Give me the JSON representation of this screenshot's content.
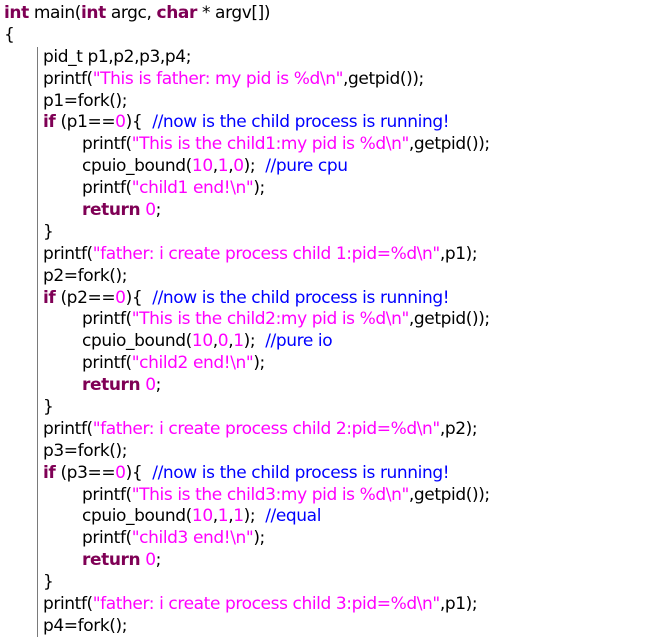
{
  "editor": {
    "lines": [
      {
        "parts": [
          {
            "t": "int",
            "c": "type"
          },
          {
            "t": " main(",
            "c": ""
          },
          {
            "t": "int",
            "c": "type"
          },
          {
            "t": " argc, ",
            "c": ""
          },
          {
            "t": "char",
            "c": "type"
          },
          {
            "t": " * argv[])",
            "c": ""
          }
        ],
        "indent": 0
      },
      {
        "parts": [
          {
            "t": "{",
            "c": ""
          }
        ],
        "indent": 0
      },
      {
        "parts": [
          {
            "t": "pid_t p1,p2,p3,p4;",
            "c": ""
          }
        ],
        "indent": 1
      },
      {
        "parts": [
          {
            "t": "printf(",
            "c": ""
          },
          {
            "t": "\"This is father: my pid is %d\\n\"",
            "c": "str"
          },
          {
            "t": ",getpid());",
            "c": ""
          }
        ],
        "indent": 1
      },
      {
        "parts": [
          {
            "t": "p1=fork();",
            "c": ""
          }
        ],
        "indent": 1
      },
      {
        "parts": [
          {
            "t": "if",
            "c": "kw"
          },
          {
            "t": " (p1==",
            "c": ""
          },
          {
            "t": "0",
            "c": "num"
          },
          {
            "t": "){  ",
            "c": ""
          },
          {
            "t": "//now is the child process is running!",
            "c": "cmt"
          }
        ],
        "indent": 1
      },
      {
        "parts": [
          {
            "t": "printf(",
            "c": ""
          },
          {
            "t": "\"This is the child1:my pid is %d\\n\"",
            "c": "str"
          },
          {
            "t": ",getpid());",
            "c": ""
          }
        ],
        "indent": 2
      },
      {
        "parts": [
          {
            "t": "cpuio_bound(",
            "c": ""
          },
          {
            "t": "10",
            "c": "num"
          },
          {
            "t": ",",
            "c": ""
          },
          {
            "t": "1",
            "c": "num"
          },
          {
            "t": ",",
            "c": ""
          },
          {
            "t": "0",
            "c": "num"
          },
          {
            "t": ");  ",
            "c": ""
          },
          {
            "t": "//pure cpu",
            "c": "cmt"
          }
        ],
        "indent": 2
      },
      {
        "parts": [
          {
            "t": "printf(",
            "c": ""
          },
          {
            "t": "\"child1 end!\\n\"",
            "c": "str"
          },
          {
            "t": ");",
            "c": ""
          }
        ],
        "indent": 2
      },
      {
        "parts": [
          {
            "t": "return",
            "c": "kw"
          },
          {
            "t": " ",
            "c": ""
          },
          {
            "t": "0",
            "c": "num"
          },
          {
            "t": ";",
            "c": ""
          }
        ],
        "indent": 2
      },
      {
        "parts": [
          {
            "t": "}",
            "c": ""
          }
        ],
        "indent": 1
      },
      {
        "parts": [
          {
            "t": "printf(",
            "c": ""
          },
          {
            "t": "\"father: i create process child 1:pid=%d\\n\"",
            "c": "str"
          },
          {
            "t": ",p1);",
            "c": ""
          }
        ],
        "indent": 1
      },
      {
        "parts": [
          {
            "t": "p2=fork();",
            "c": ""
          }
        ],
        "indent": 1
      },
      {
        "parts": [
          {
            "t": "if",
            "c": "kw"
          },
          {
            "t": " (p2==",
            "c": ""
          },
          {
            "t": "0",
            "c": "num"
          },
          {
            "t": "){  ",
            "c": ""
          },
          {
            "t": "//now is the child process is running!",
            "c": "cmt"
          }
        ],
        "indent": 1
      },
      {
        "parts": [
          {
            "t": "printf(",
            "c": ""
          },
          {
            "t": "\"This is the child2:my pid is %d\\n\"",
            "c": "str"
          },
          {
            "t": ",getpid());",
            "c": ""
          }
        ],
        "indent": 2
      },
      {
        "parts": [
          {
            "t": "cpuio_bound(",
            "c": ""
          },
          {
            "t": "10",
            "c": "num"
          },
          {
            "t": ",",
            "c": ""
          },
          {
            "t": "0",
            "c": "num"
          },
          {
            "t": ",",
            "c": ""
          },
          {
            "t": "1",
            "c": "num"
          },
          {
            "t": ");  ",
            "c": ""
          },
          {
            "t": "//pure io",
            "c": "cmt"
          }
        ],
        "indent": 2
      },
      {
        "parts": [
          {
            "t": "printf(",
            "c": ""
          },
          {
            "t": "\"child2 end!\\n\"",
            "c": "str"
          },
          {
            "t": ");",
            "c": ""
          }
        ],
        "indent": 2
      },
      {
        "parts": [
          {
            "t": "return",
            "c": "kw"
          },
          {
            "t": " ",
            "c": ""
          },
          {
            "t": "0",
            "c": "num"
          },
          {
            "t": ";",
            "c": ""
          }
        ],
        "indent": 2
      },
      {
        "parts": [
          {
            "t": "}",
            "c": ""
          }
        ],
        "indent": 1
      },
      {
        "parts": [
          {
            "t": "printf(",
            "c": ""
          },
          {
            "t": "\"father: i create process child 2:pid=%d\\n\"",
            "c": "str"
          },
          {
            "t": ",p2);",
            "c": ""
          }
        ],
        "indent": 1
      },
      {
        "parts": [
          {
            "t": "p3=fork();",
            "c": ""
          }
        ],
        "indent": 1
      },
      {
        "parts": [
          {
            "t": "if",
            "c": "kw"
          },
          {
            "t": " (p3==",
            "c": ""
          },
          {
            "t": "0",
            "c": "num"
          },
          {
            "t": "){  ",
            "c": ""
          },
          {
            "t": "//now is the child process is running!",
            "c": "cmt"
          }
        ],
        "indent": 1
      },
      {
        "parts": [
          {
            "t": "printf(",
            "c": ""
          },
          {
            "t": "\"This is the child3:my pid is %d\\n\"",
            "c": "str"
          },
          {
            "t": ",getpid());",
            "c": ""
          }
        ],
        "indent": 2
      },
      {
        "parts": [
          {
            "t": "cpuio_bound(",
            "c": ""
          },
          {
            "t": "10",
            "c": "num"
          },
          {
            "t": ",",
            "c": ""
          },
          {
            "t": "1",
            "c": "num"
          },
          {
            "t": ",",
            "c": ""
          },
          {
            "t": "1",
            "c": "num"
          },
          {
            "t": ");  ",
            "c": ""
          },
          {
            "t": "//equal",
            "c": "cmt"
          }
        ],
        "indent": 2
      },
      {
        "parts": [
          {
            "t": "printf(",
            "c": ""
          },
          {
            "t": "\"child3 end!\\n\"",
            "c": "str"
          },
          {
            "t": ");",
            "c": ""
          }
        ],
        "indent": 2
      },
      {
        "parts": [
          {
            "t": "return",
            "c": "kw"
          },
          {
            "t": " ",
            "c": ""
          },
          {
            "t": "0",
            "c": "num"
          },
          {
            "t": ";",
            "c": ""
          }
        ],
        "indent": 2
      },
      {
        "parts": [
          {
            "t": "}",
            "c": ""
          }
        ],
        "indent": 1
      },
      {
        "parts": [
          {
            "t": "printf(",
            "c": ""
          },
          {
            "t": "\"father: i create process child 3:pid=%d\\n\"",
            "c": "str"
          },
          {
            "t": ",p1);",
            "c": ""
          }
        ],
        "indent": 1
      },
      {
        "parts": [
          {
            "t": "p4=fork();",
            "c": ""
          }
        ],
        "indent": 1
      }
    ],
    "colors": {
      "keyword": "#7f0055",
      "string": "#ff00ff",
      "comment": "#0000ff",
      "number": "#ff00ff",
      "text": "#000000",
      "background": "#ffffff"
    }
  }
}
